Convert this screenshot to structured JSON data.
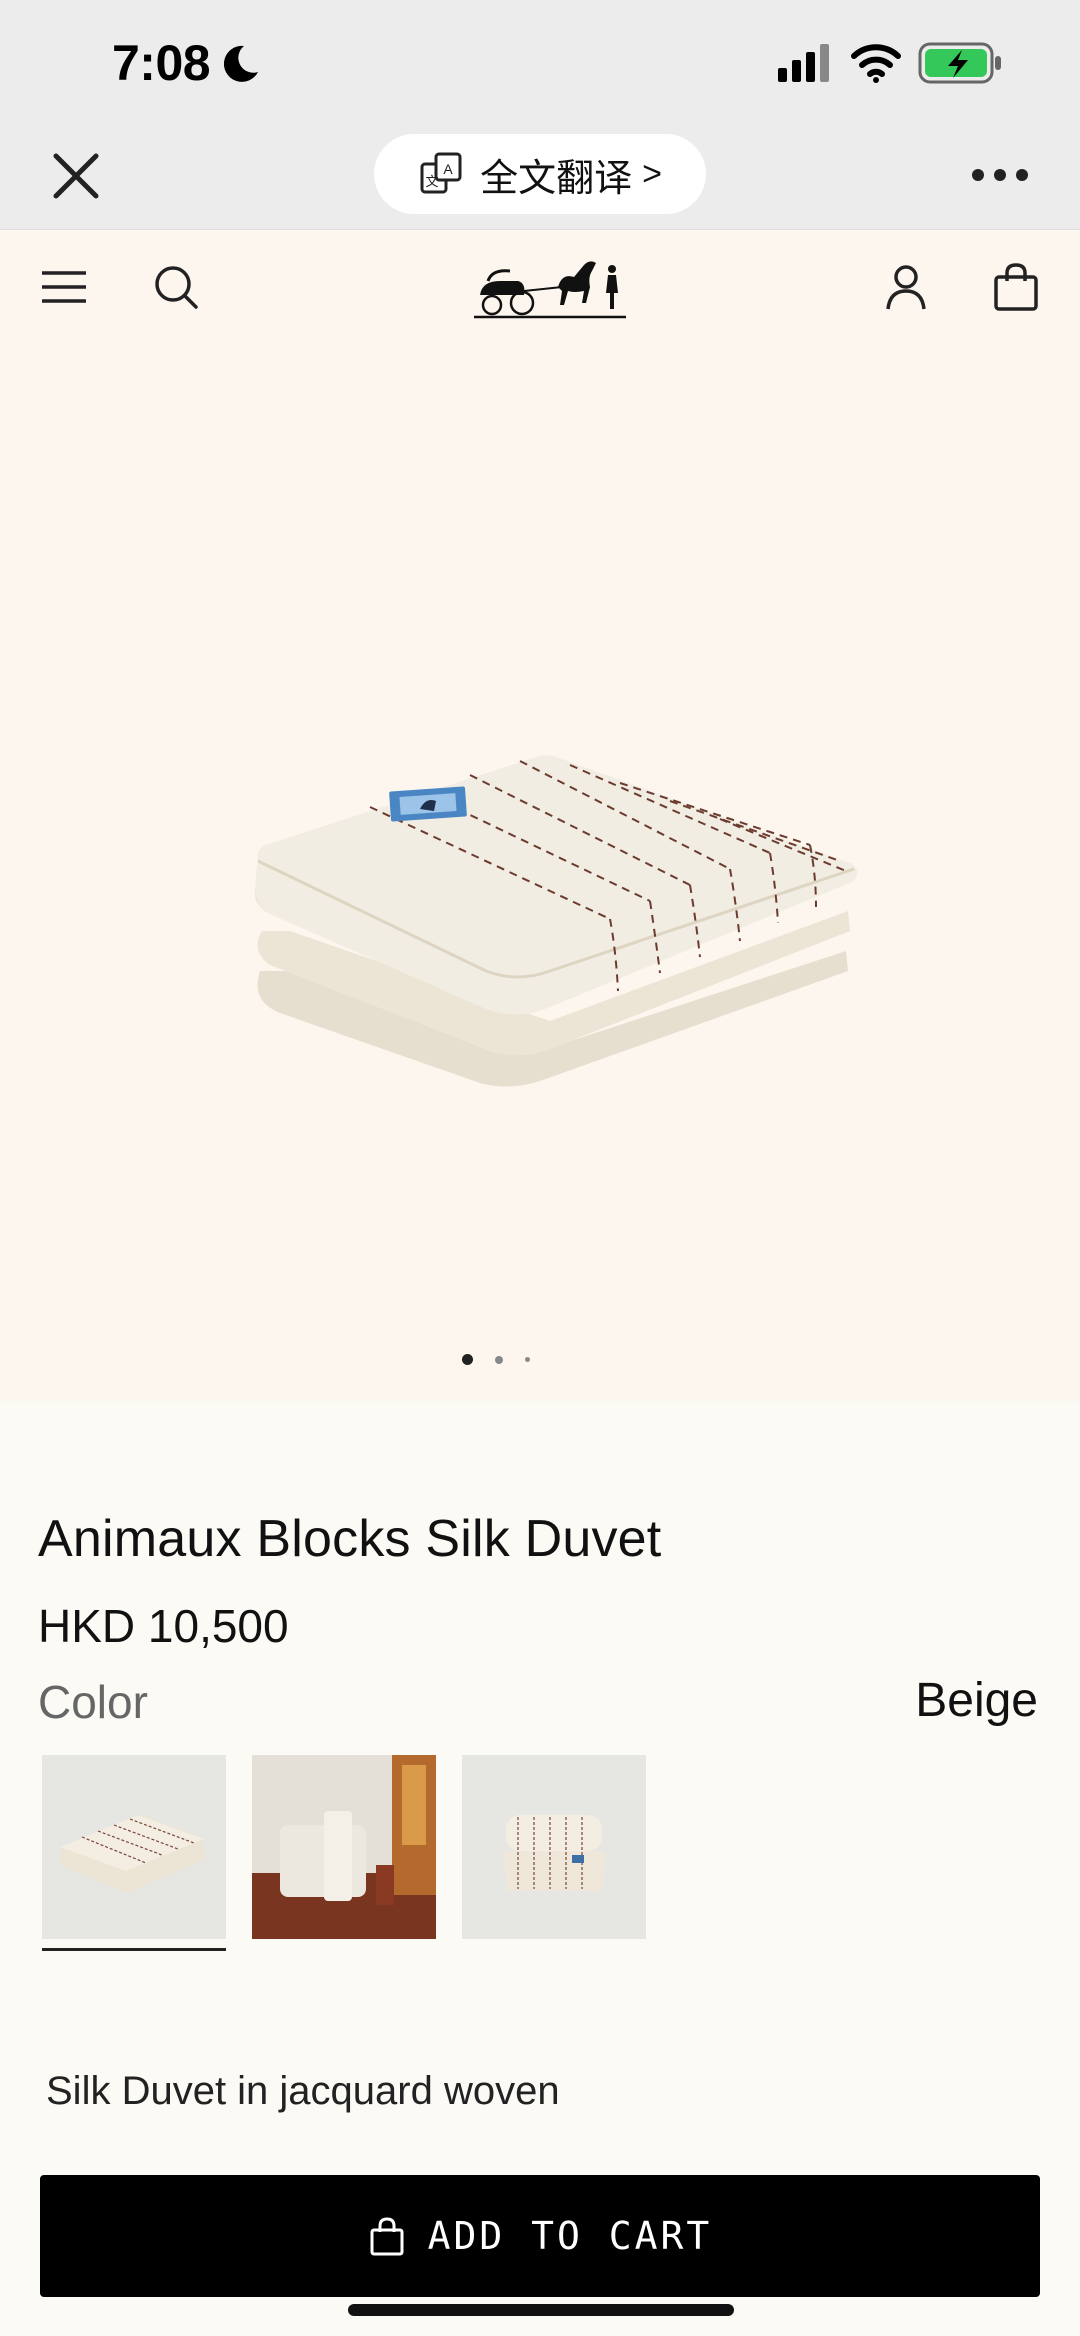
{
  "status_bar": {
    "time": "7:08",
    "icons": [
      "moon-icon",
      "cellular-signal-icon",
      "wifi-icon",
      "battery-charging-icon"
    ]
  },
  "browser_bar": {
    "close_icon": "close-icon",
    "translate_label": "全文翻译",
    "translate_icon": "translate-icon",
    "translate_chevron": ">",
    "more_icon": "more-dots-icon"
  },
  "site_header": {
    "menu_icon": "hamburger-icon",
    "search_icon": "search-icon",
    "logo": "carriage-logo",
    "account_icon": "user-icon",
    "bag_icon": "shopping-bag-icon"
  },
  "carousel": {
    "current_slide": 1,
    "total_slides": 3
  },
  "product": {
    "title": "Animaux Blocks Silk Duvet",
    "price": "HKD 10,500",
    "color_label": "Color",
    "color_value": "Beige",
    "thumbnails": [
      {
        "name": "folded-duvet",
        "selected": true
      },
      {
        "name": "duvet-on-armchair",
        "selected": false
      },
      {
        "name": "duvet-rolled-flat",
        "selected": false
      }
    ],
    "description": "Silk Duvet in jacquard woven"
  },
  "cta": {
    "add_to_cart_label": "ADD TO CART",
    "bag_icon": "shopping-bag-icon"
  },
  "colors": {
    "hero_bg": "#fcf6ef",
    "page_bg": "#fcfaf5",
    "button_bg": "#000000",
    "battery_green": "#34c759"
  }
}
